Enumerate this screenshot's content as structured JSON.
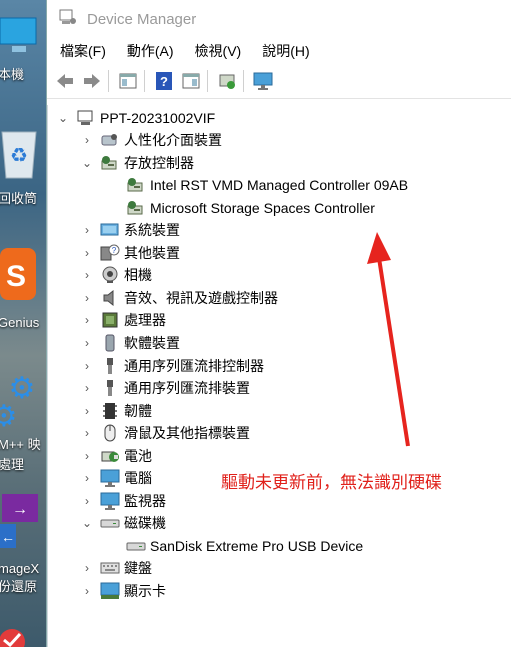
{
  "desktop": {
    "labels": [
      "本機",
      "回收筒",
      "Genius",
      "M++ 映",
      "處理",
      "mageX",
      "份還原"
    ]
  },
  "window": {
    "title": "Device Manager",
    "menu": [
      "檔案(F)",
      "動作(A)",
      "檢視(V)",
      "說明(H)"
    ]
  },
  "tree": {
    "root": "PPT-20231002VIF",
    "items": [
      {
        "label": "人性化介面裝置",
        "icon": "hid-icon"
      },
      {
        "label": "存放控制器",
        "icon": "storage-controller-icon",
        "expanded": true
      },
      {
        "label": "Intel RST VMD Managed Controller 09AB",
        "icon": "storage-controller-icon",
        "child": true
      },
      {
        "label": "Microsoft Storage Spaces Controller",
        "icon": "storage-controller-icon",
        "child": true
      },
      {
        "label": "系統裝置",
        "icon": "system-icon"
      },
      {
        "label": "其他裝置",
        "icon": "unknown-device-icon"
      },
      {
        "label": "相機",
        "icon": "camera-icon"
      },
      {
        "label": "音效、視訊及遊戲控制器",
        "icon": "speaker-icon"
      },
      {
        "label": "處理器",
        "icon": "cpu-icon"
      },
      {
        "label": "軟體裝置",
        "icon": "software-device-icon"
      },
      {
        "label": "通用序列匯流排控制器",
        "icon": "usb-icon"
      },
      {
        "label": "通用序列匯流排裝置",
        "icon": "usb-icon"
      },
      {
        "label": "韌體",
        "icon": "firmware-icon"
      },
      {
        "label": "滑鼠及其他指標裝置",
        "icon": "mouse-icon"
      },
      {
        "label": "電池",
        "icon": "battery-icon"
      },
      {
        "label": "電腦",
        "icon": "computer-icon"
      },
      {
        "label": "監視器",
        "icon": "monitor-icon"
      },
      {
        "label": "磁碟機",
        "icon": "disk-drive-icon",
        "expanded": true
      },
      {
        "label": "SanDisk Extreme Pro USB Device",
        "icon": "disk-drive-icon",
        "child": true
      },
      {
        "label": "鍵盤",
        "icon": "keyboard-icon"
      },
      {
        "label": "顯示卡",
        "icon": "display-adapter-icon"
      }
    ]
  },
  "annotation": {
    "text": "驅動未更新前，無法識別硬碟",
    "color": "#e0201a"
  }
}
